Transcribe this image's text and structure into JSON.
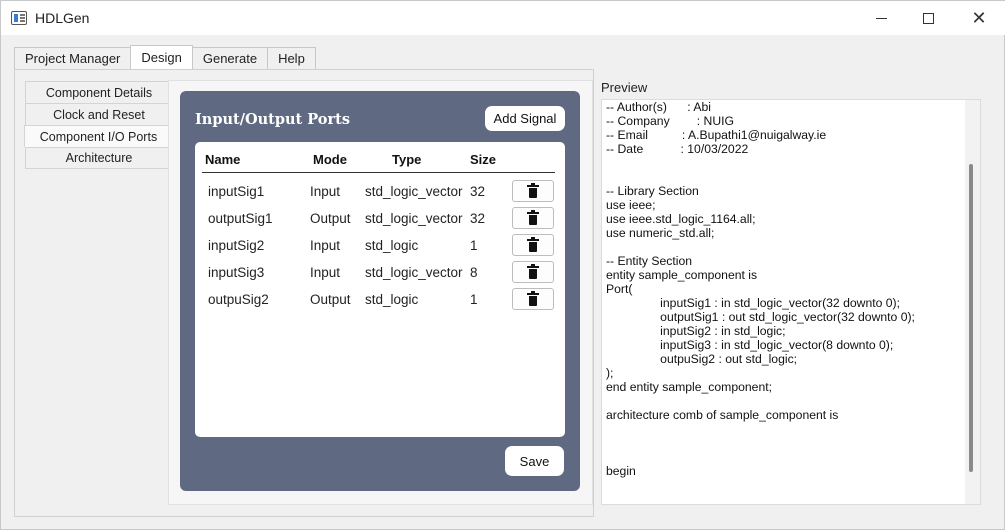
{
  "window": {
    "title": "HDLGen",
    "close_glyph": "✕"
  },
  "tabs": [
    {
      "label": "Project Manager",
      "active": false
    },
    {
      "label": "Design",
      "active": true
    },
    {
      "label": "Generate",
      "active": false
    },
    {
      "label": "Help",
      "active": false
    }
  ],
  "subtabs": [
    {
      "label": "Component Details",
      "active": false
    },
    {
      "label": "Clock and Reset",
      "active": false
    },
    {
      "label": "Component I/O Ports",
      "active": true
    },
    {
      "label": "Architecture",
      "active": false
    }
  ],
  "ports_panel": {
    "title": "Input/Output Ports",
    "add_signal_label": "Add Signal",
    "save_label": "Save",
    "columns": [
      "Name",
      "Mode",
      "Type",
      "Size"
    ],
    "rows": [
      {
        "name": "inputSig1",
        "mode": "Input",
        "type": "std_logic_vector",
        "size": "32"
      },
      {
        "name": "outputSig1",
        "mode": "Output",
        "type": "std_logic_vector",
        "size": "32"
      },
      {
        "name": "inputSig2",
        "mode": "Input",
        "type": "std_logic",
        "size": "1"
      },
      {
        "name": "inputSig3",
        "mode": "Input",
        "type": "std_logic_vector",
        "size": "8"
      },
      {
        "name": "outpuSig2",
        "mode": "Output",
        "type": "std_logic",
        "size": "1"
      }
    ]
  },
  "preview": {
    "label": "Preview",
    "lines": [
      "-- Author(s)      : Abi",
      "-- Company        : NUIG",
      "-- Email          : A.Bupathi1@nuigalway.ie",
      "-- Date           : 10/03/2022",
      "",
      "",
      "-- Library Section",
      "use ieee;",
      "use ieee.std_logic_1164.all;",
      "use numeric_std.all;",
      "",
      "-- Entity Section",
      "entity sample_component is",
      "Port(",
      "                inputSig1 : in std_logic_vector(32 downto 0);",
      "                outputSig1 : out std_logic_vector(32 downto 0);",
      "                inputSig2 : in std_logic;",
      "                inputSig3 : in std_logic_vector(8 downto 0);",
      "                outpuSig2 : out std_logic;",
      ");",
      "end entity sample_component;",
      "",
      "architecture comb of sample_component is",
      "",
      "",
      "",
      "begin"
    ]
  }
}
